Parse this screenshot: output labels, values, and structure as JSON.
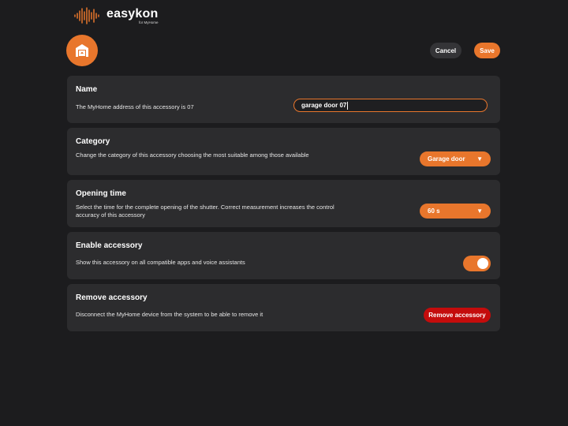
{
  "brand": {
    "name": "easykon",
    "subtitle": "for MyHome",
    "logo_icon": "soundwave-icon",
    "accent_color": "#e8762c"
  },
  "header": {
    "accessory_icon": "garage-icon",
    "cancel_label": "Cancel",
    "save_label": "Save"
  },
  "name_card": {
    "title": "Name",
    "description": "The MyHome address of this accessory is 07",
    "input_value": "garage door 07"
  },
  "category_card": {
    "title": "Category",
    "description": "Change the category of this accessory choosing the most suitable among those available",
    "selected": "Garage door"
  },
  "opening_card": {
    "title": "Opening time",
    "description": "Select the time for the complete opening of the shutter. Correct measurement increases the control accuracy of this accessory",
    "selected": "60 s"
  },
  "enable_card": {
    "title": "Enable accessory",
    "description": "Show this accessory on all compatible apps and voice assistants",
    "enabled": true
  },
  "remove_card": {
    "title": "Remove accessory",
    "description": "Disconnect the MyHome device from the system to be able to remove it",
    "button_label": "Remove accessory",
    "button_color": "#c40c0c"
  }
}
